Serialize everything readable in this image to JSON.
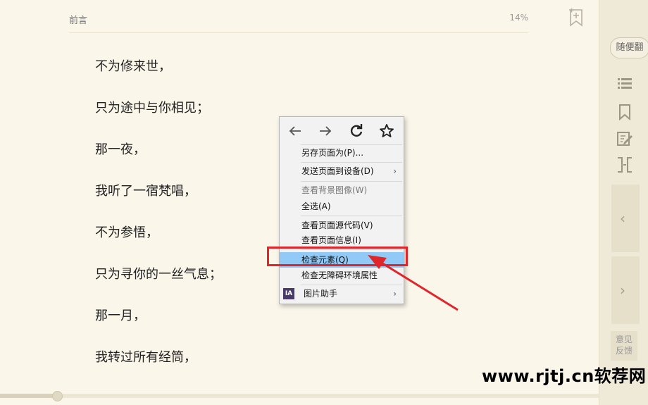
{
  "header": {
    "chapter": "前言",
    "percent": "14%"
  },
  "content": {
    "lines": [
      "不为修来世，",
      "只为途中与你相见；",
      "那一夜，",
      "我听了一宿梵唱，",
      "不为参悟，",
      "只为寻你的一丝气息；",
      "那一月，",
      "我转过所有经筒，"
    ]
  },
  "progress": {
    "fraction": 0.095
  },
  "sidebar": {
    "random_label": "随便翻",
    "feedback_label": "意见\n反馈",
    "icons": [
      "toc-icon",
      "bookmark-icon",
      "note-icon",
      "width-toggle-icon"
    ]
  },
  "context_menu": {
    "nav_icons": [
      "back-icon",
      "forward-icon",
      "reload-icon",
      "bookmark-star-icon"
    ],
    "items": {
      "save_page": "另存页面为(P)...",
      "send_page": "发送页面到设备(D)",
      "view_bg": "查看背景图像(W)",
      "select_all": "全选(A)",
      "view_source": "查看页面源代码(V)",
      "view_info": "查看页面信息(I)",
      "inspect": "检查元素(Q)",
      "inspect_a11y": "检查无障碍环境属性",
      "image_helper": "图片助手"
    },
    "image_helper_badge": "IA"
  },
  "annotation": {
    "box_color": "#e0262a",
    "arrow_color": "#e0262a"
  },
  "watermark": {
    "text": "www.rjtj.cn软荐网"
  }
}
